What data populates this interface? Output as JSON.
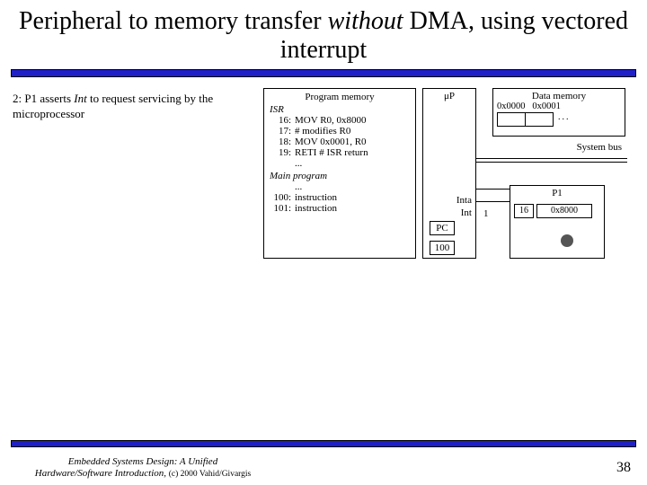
{
  "title": {
    "pre": "Peripheral to memory transfer ",
    "em": "without",
    "post": " DMA, using vectored interrupt"
  },
  "step": {
    "pre": "2: P1 asserts ",
    "em": "Int",
    "post": " to request servicing by the microprocessor"
  },
  "program_memory": {
    "header": "Program memory",
    "isr_label": "ISR",
    "isr": [
      {
        "addr": "16:",
        "instr": "MOV R0, 0x8000"
      },
      {
        "addr": "17:",
        "instr": "# modifies R0"
      },
      {
        "addr": "18:",
        "instr": "MOV 0x0001, R0"
      },
      {
        "addr": "19:",
        "instr": "RETI  # ISR return"
      }
    ],
    "isr_ellipsis": "...",
    "main_label": "Main program",
    "main_ellipsis": "...",
    "main": [
      {
        "addr": "100:",
        "instr": "instruction"
      },
      {
        "addr": "101:",
        "instr": "instruction"
      }
    ]
  },
  "microprocessor": {
    "label": "μP",
    "signal_inta": "Inta",
    "signal_int": "Int",
    "pc_label": "PC",
    "pc_value": "100"
  },
  "bus": {
    "one": "1"
  },
  "data_memory": {
    "header": "Data memory",
    "addr0": "0x0000",
    "addr1": "0x0001",
    "dots": "..."
  },
  "system_bus": "System bus",
  "p1": {
    "header": "P1",
    "sixteen": "16",
    "addr": "0x8000"
  },
  "footer": {
    "line1": "Embedded Systems Design: A Unified",
    "line2_pre": "Hardware/Software Introduction, ",
    "line2_sub": "(c) 2000 Vahid/Givargis"
  },
  "page": "38"
}
